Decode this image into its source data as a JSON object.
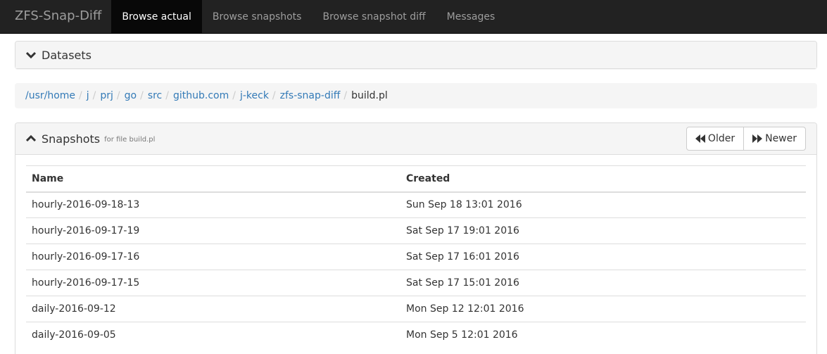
{
  "navbar": {
    "brand": "ZFS-Snap-Diff",
    "tabs": [
      {
        "label": "Browse actual",
        "active": true
      },
      {
        "label": "Browse snapshots",
        "active": false
      },
      {
        "label": "Browse snapshot diff",
        "active": false
      },
      {
        "label": "Messages",
        "active": false
      }
    ]
  },
  "datasets": {
    "title": "Datasets",
    "icon": "chevron-down-icon"
  },
  "breadcrumb": {
    "items": [
      "/usr/home",
      "j",
      "prj",
      "go",
      "src",
      "github.com",
      "j-keck",
      "zfs-snap-diff"
    ],
    "current": "build.pl",
    "separator": "/"
  },
  "snapshots": {
    "title": "Snapshots",
    "subtitle": "for file build.pl",
    "icon": "chevron-up-icon",
    "older_label": "Older",
    "newer_label": "Newer",
    "columns": [
      "Name",
      "Created"
    ],
    "rows": [
      {
        "name": "hourly-2016-09-18-13",
        "created": "Sun Sep 18 13:01 2016"
      },
      {
        "name": "hourly-2016-09-17-19",
        "created": "Sat Sep 17 19:01 2016"
      },
      {
        "name": "hourly-2016-09-17-16",
        "created": "Sat Sep 17 16:01 2016"
      },
      {
        "name": "hourly-2016-09-17-15",
        "created": "Sat Sep 17 15:01 2016"
      },
      {
        "name": "daily-2016-09-12",
        "created": "Mon Sep 12 12:01 2016"
      },
      {
        "name": "daily-2016-09-05",
        "created": "Mon Sep 5 12:01 2016"
      }
    ]
  },
  "colors": {
    "navbar_bg": "#222222",
    "navbar_active_bg": "#080808",
    "link": "#337ab7",
    "panel_heading_bg": "#f5f5f5"
  }
}
